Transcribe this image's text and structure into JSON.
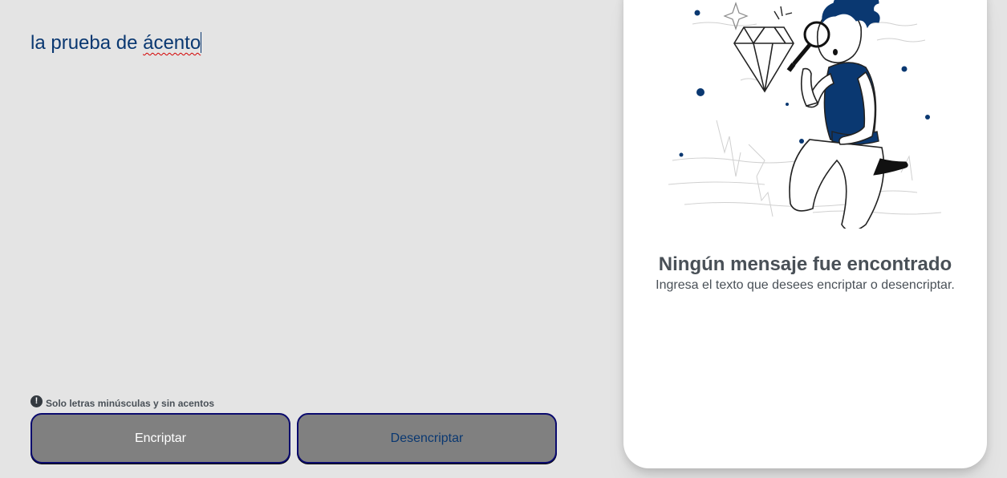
{
  "input": {
    "text_plain": "la prueba de ",
    "text_misspelled": "ácento"
  },
  "hint": {
    "icon": "exclamation-circle-icon",
    "text": "Solo letras minúsculas y sin acentos"
  },
  "buttons": {
    "encrypt_label": "Encriptar",
    "decrypt_label": "Desencriptar"
  },
  "output": {
    "illustration": "person-with-magnifying-glass-looking-at-diamond",
    "title": "Ningún mensaje fue encontrado",
    "subtitle": "Ingresa el texto que desees encriptar o desencriptar."
  },
  "colors": {
    "background": "#e4e4e4",
    "accent": "#0a3871",
    "button_fill": "#808080",
    "card": "#ffffff",
    "text_gray": "#495057"
  }
}
